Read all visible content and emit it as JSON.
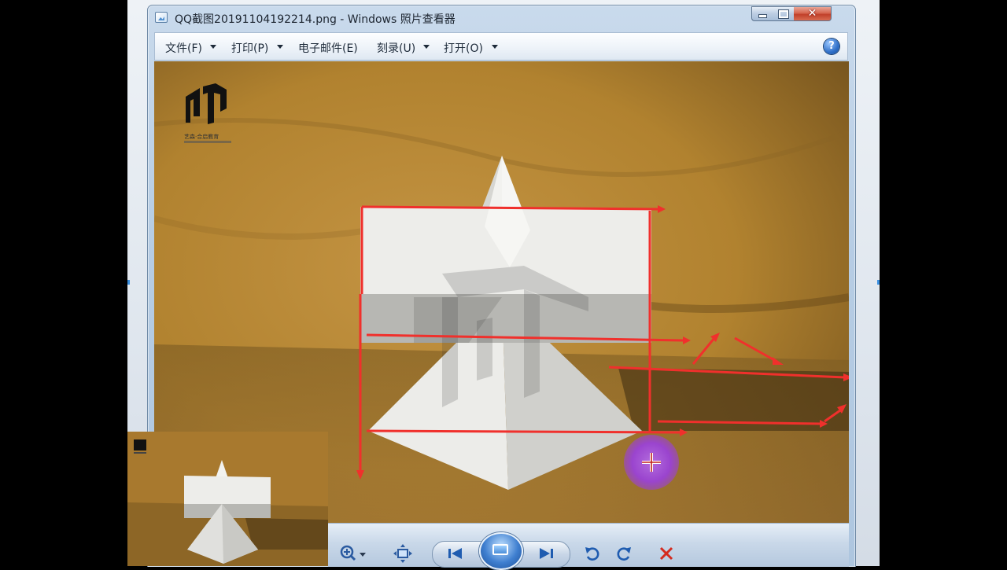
{
  "window": {
    "title": "QQ截图20191104192214.png - Windows 照片查看器",
    "controls": {
      "minimize": "minimize",
      "maximize": "maximize",
      "close": "close"
    }
  },
  "menubar": {
    "items": [
      {
        "label": "文件(F)",
        "has_dropdown": true
      },
      {
        "label": "打印(P)",
        "has_dropdown": true
      },
      {
        "label": "电子邮件(E)",
        "has_dropdown": false
      },
      {
        "label": "刻录(U)",
        "has_dropdown": true
      },
      {
        "label": "打开(O)",
        "has_dropdown": true
      }
    ],
    "help_label": "?"
  },
  "photo": {
    "watermark_brand": "艺森·合启教育",
    "colors": {
      "backdrop": "#b98a3a",
      "plaster": "#e9e9e6",
      "arrow": "#f0302c",
      "cursor_glow": "#9b3de0"
    }
  },
  "controls": {
    "icons": [
      "zoom-icon",
      "fit-to-window-icon",
      "previous-icon",
      "slideshow-icon",
      "next-icon",
      "rotate-counterclockwise-icon",
      "rotate-clockwise-icon",
      "delete-icon"
    ]
  }
}
